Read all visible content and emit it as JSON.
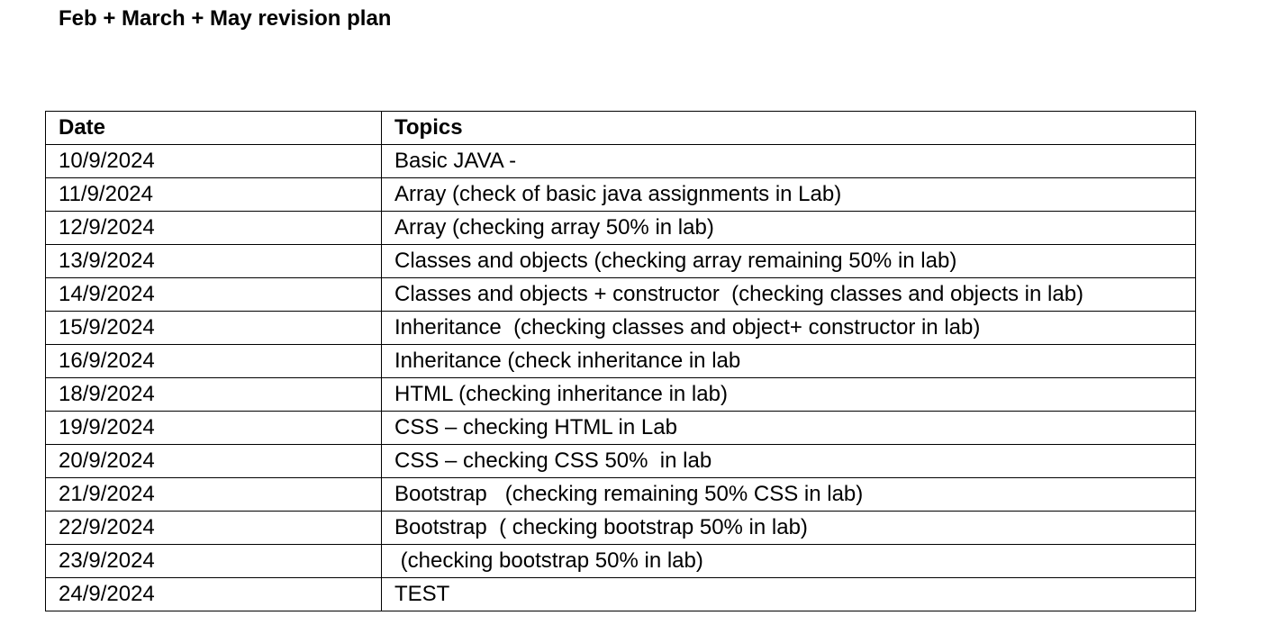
{
  "document": {
    "title": "Feb + March + May revision plan"
  },
  "table": {
    "headers": {
      "date": "Date",
      "topics": "Topics"
    },
    "rows": [
      {
        "date": "10/9/2024",
        "topic": "Basic JAVA -"
      },
      {
        "date": "11/9/2024",
        "topic": "Array (check of basic java assignments in Lab)"
      },
      {
        "date": "12/9/2024",
        "topic": "Array (checking array 50% in lab)"
      },
      {
        "date": "13/9/2024",
        "topic": "Classes and objects (checking array remaining 50% in lab)"
      },
      {
        "date": "14/9/2024",
        "topic": "Classes and objects + constructor  (checking classes and objects in lab)"
      },
      {
        "date": "15/9/2024",
        "topic": "Inheritance  (checking classes and object+ constructor in lab)"
      },
      {
        "date": "16/9/2024",
        "topic": "Inheritance (check inheritance in lab"
      },
      {
        "date": "18/9/2024",
        "topic": "HTML (checking inheritance in lab)"
      },
      {
        "date": "19/9/2024",
        "topic": "CSS – checking HTML in Lab"
      },
      {
        "date": "20/9/2024",
        "topic": "CSS – checking CSS 50%  in lab"
      },
      {
        "date": "21/9/2024",
        "topic": "Bootstrap   (checking remaining 50% CSS in lab)"
      },
      {
        "date": "22/9/2024",
        "topic": "Bootstrap  ( checking bootstrap 50% in lab)"
      },
      {
        "date": "23/9/2024",
        "topic": " (checking bootstrap 50% in lab)"
      },
      {
        "date": "24/9/2024",
        "topic": "TEST"
      }
    ]
  }
}
